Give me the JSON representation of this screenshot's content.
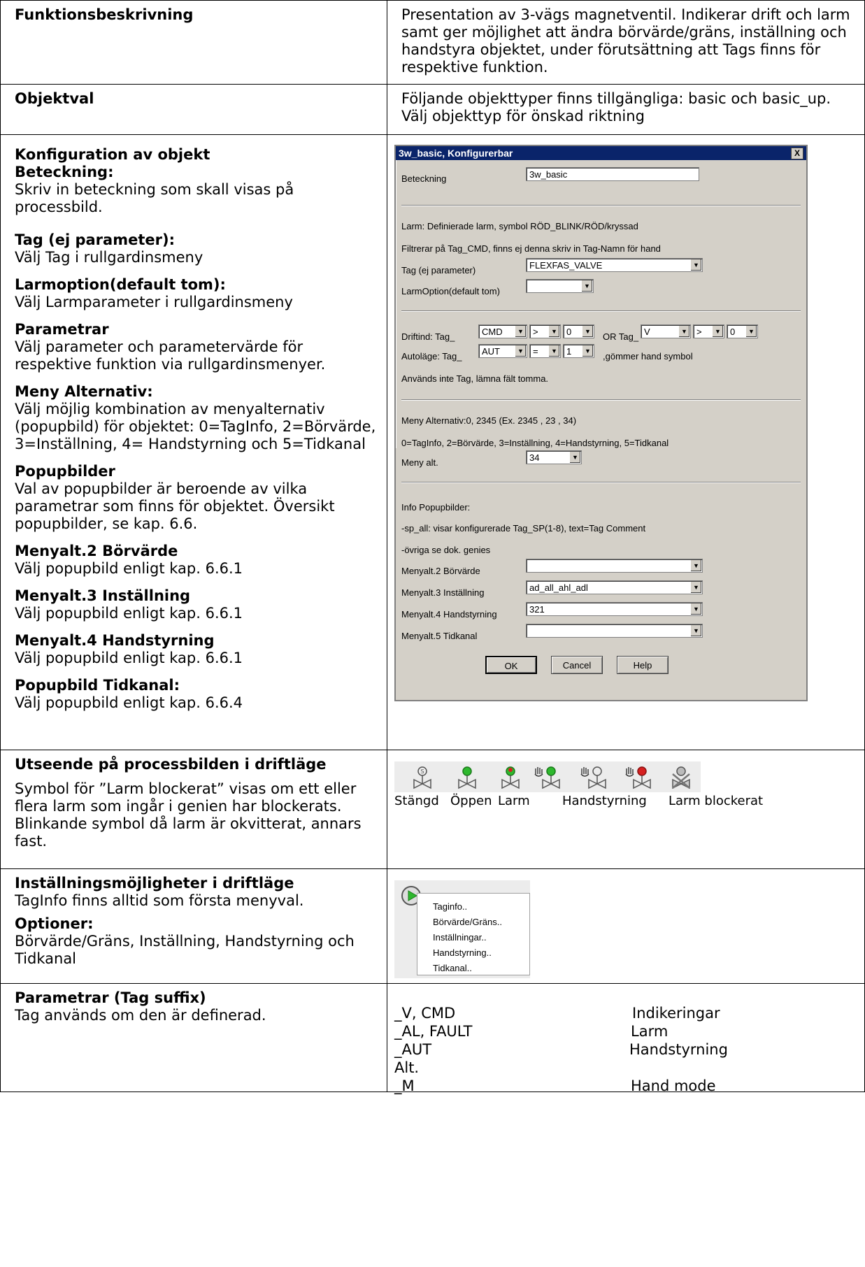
{
  "rows": {
    "funktion": {
      "label": "Funktionsbeskrivning",
      "text": "Presentation av 3-vägs magnetventil. Indikerar drift och larm samt ger möjlighet att ändra börvärde/gräns, inställning och handstyra objektet, under förutsättning att Tags finns för respektive funktion."
    },
    "objektval": {
      "label": "Objektval",
      "text": "Följande objekttyper finns tillgängliga: basic och basic_up. Välj objekttyp för önskad riktning"
    },
    "konfig": {
      "title": "Konfiguration av objekt",
      "beteckning_h": "Beteckning:",
      "beteckning_t": "Skriv in beteckning som skall visas på processbild.",
      "tag_h": "Tag (ej parameter):",
      "tag_t": "Välj Tag i rullgardinsmeny",
      "larm_h": "Larmoption(default tom):",
      "larm_t": "Välj  Larmparameter i rullgardinsmeny",
      "param_h": "Parametrar",
      "param_t": "Välj parameter och parametervärde för respektive funktion via rullgardinsmenyer.",
      "meny_h": "Meny Alternativ:",
      "meny_t": "Välj möjlig kombination av menyalternativ (popupbild) för objektet: 0=TagInfo, 2=Börvärde, 3=Inställning, 4= Handstyrning och 5=Tidkanal",
      "popup_h": "Popupbilder",
      "popup_t": "Val av popupbilder är beroende av vilka parametrar som finns för objektet. Översikt popupbilder, se kap. 6.6.",
      "m2_h": "Menyalt.2 Börvärde",
      "m2_t": "Välj popupbild enligt kap. 6.6.1",
      "m3_h": "Menyalt.3 Inställning",
      "m3_t": "Välj popupbild enligt kap. 6.6.1",
      "m4_h": "Menyalt.4 Handstyrning",
      "m4_t": "Välj popupbild enligt kap. 6.6.1",
      "tid_h": "Popupbild Tidkanal:",
      "tid_t": "Välj popupbild enligt kap. 6.6.4"
    },
    "utseende": {
      "label": "Utseende på processbilden i driftläge",
      "text": "Symbol för ”Larm blockerat” visas om ett eller flera larm som ingår i genien har blockerats. Blinkande symbol då larm är okvitterat, annars fast.",
      "symbols": [
        "Stängd",
        "Öppen",
        "Larm",
        "Handstyrning",
        "Larm blockerat"
      ]
    },
    "installning": {
      "label": "Inställningsmöjligheter i driftläge",
      "text": "TagInfo finns alltid som första menyval.",
      "opt_h": "Optioner:",
      "opt_t": "Börvärde/Gräns, Inställning,  Handstyrning och Tidkanal",
      "menu": [
        "Taginfo..",
        "Börvärde/Gräns..",
        "Inställningar..",
        "Handstyrning..",
        "Tidkanal.."
      ]
    },
    "parametrar": {
      "label": "Parametrar (Tag suffix)",
      "text": "Tag används om den är definerad.",
      "items": [
        {
          "tag": "_V, CMD",
          "desc": "Indikeringar"
        },
        {
          "tag": "_AL, FAULT",
          "desc": "Larm"
        },
        {
          "tag": "_AUT",
          "desc": "Handstyrning"
        },
        {
          "tag": "Alt.",
          "desc": ""
        },
        {
          "tag": "_M",
          "desc": "Hand mode"
        }
      ]
    }
  },
  "dialog": {
    "title": "3w_basic, Konfigurerbar",
    "close": "X",
    "beteckning_label": "Beteckning",
    "beteckning_value": "3w_basic",
    "larm_info": "Larm: Definierade larm, symbol RÖD_BLINK/RÖD/kryssad",
    "filter_info": "Filtrerar på Tag_CMD, finns ej denna skriv in Tag-Namn för hand",
    "tag_label": "Tag (ej parameter)",
    "tag_value": "FLEXFAS_VALVE",
    "larmopt_label": "LarmOption(default tom)",
    "larmopt_value": "",
    "driftind_label": "Driftind: Tag_",
    "driftind_tag": "CMD",
    "driftind_op": ">",
    "driftind_val": "0",
    "or_label": "OR Tag_",
    "or_tag": "V",
    "or_op": ">",
    "or_val": "0",
    "auto_label": "Autoläge: Tag_",
    "auto_tag": "AUT",
    "auto_op": "=",
    "auto_val": "1",
    "auto_note": ",gömmer hand symbol",
    "empty_note": "Används inte Tag, lämna fält tomma.",
    "meny_info1": "Meny Alternativ:0, 2345 (Ex. 2345 , 23  , 34)",
    "meny_info2": "0=TagInfo, 2=Börvärde, 3=Inställning, 4=Handstyrning, 5=Tidkanal",
    "meny_label": "Meny alt.",
    "meny_value": "34",
    "info_popup": "Info Popupbilder:",
    "sp_all": "-sp_all: visar konfigurerade Tag_SP(1-8), text=Tag Comment",
    "ovriga": "-övriga se dok. genies",
    "m2_label": "Menyalt.2 Börvärde",
    "m2_value": "",
    "m3_label": "Menyalt.3 Inställning",
    "m3_value": "ad_all_ahl_adl",
    "m4_label": "Menyalt.4 Handstyrning",
    "m4_value": "321",
    "m5_label": "Menyalt.5 Tidkanal",
    "m5_value": "",
    "ok": "OK",
    "cancel": "Cancel",
    "help": "Help"
  },
  "colors": {
    "title_bar": "#0a246a",
    "dialog_bg": "#d4d0c8",
    "green": "#2eb82e",
    "red": "#d62020"
  }
}
